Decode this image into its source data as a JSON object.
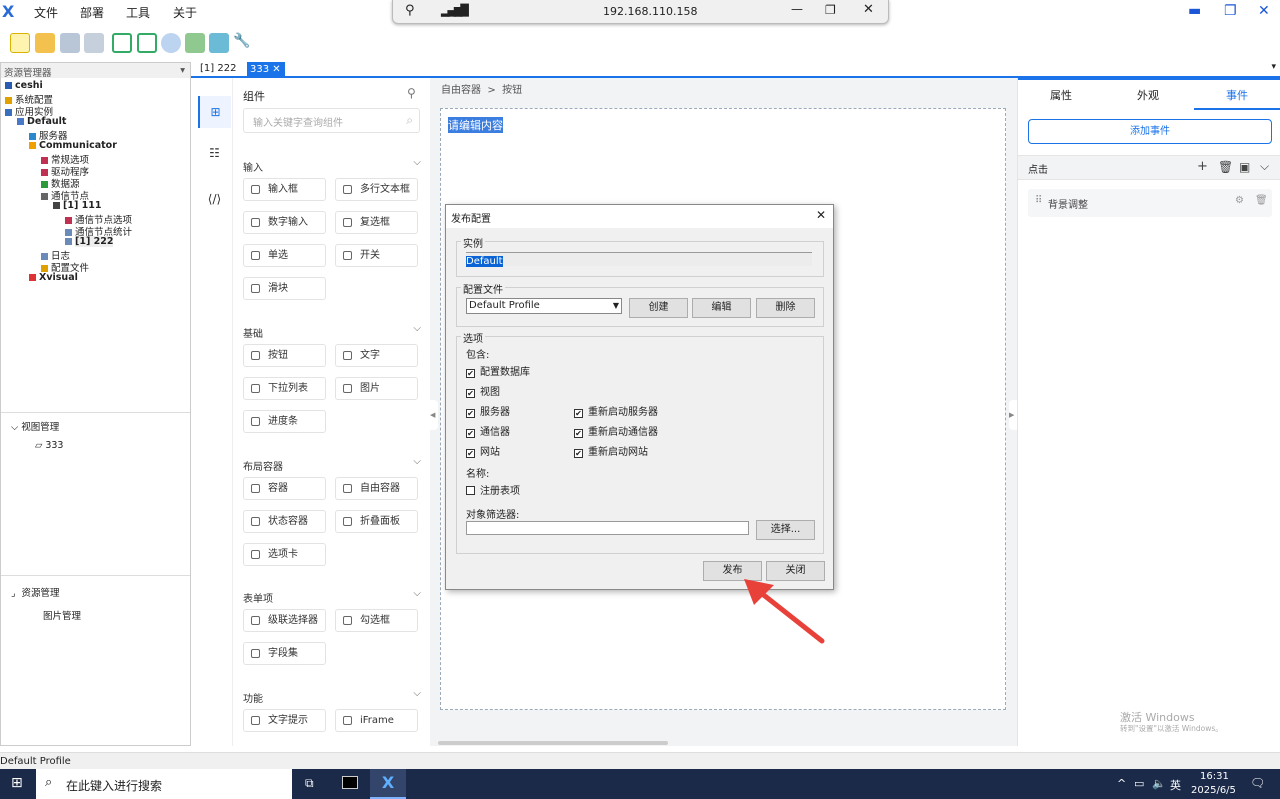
{
  "app": {
    "logo": "X",
    "menu": [
      "文件",
      "部署",
      "工具",
      "关于"
    ]
  },
  "remote": {
    "ip": "192.168.110.158"
  },
  "toolbar": {
    "icons": [
      "new-icon",
      "open-icon",
      "save-icon",
      "save-all-icon",
      "upload-icon",
      "download-icon",
      "help-icon",
      "deploy-icon",
      "add-icon",
      "tools-icon"
    ]
  },
  "tabs": [
    {
      "label": "[1] 222",
      "active": false
    },
    {
      "label": "333",
      "active": true,
      "close": "✕"
    }
  ],
  "explorer": {
    "title": "资源管理器",
    "tree": [
      {
        "label": "ceshi",
        "level": 0
      },
      {
        "label": "系统配置",
        "level": 0
      },
      {
        "label": "应用实例",
        "level": 0
      },
      {
        "label": "Default",
        "level": 1
      },
      {
        "label": "服务器",
        "level": 2
      },
      {
        "label": "Communicator",
        "level": 2
      },
      {
        "label": "常规选项",
        "level": 3
      },
      {
        "label": "驱动程序",
        "level": 3
      },
      {
        "label": "数据源",
        "level": 3
      },
      {
        "label": "通信节点",
        "level": 3
      },
      {
        "label": "[1] 111",
        "level": 4
      },
      {
        "label": "通信节点选项",
        "level": 5
      },
      {
        "label": "通信节点统计",
        "level": 5
      },
      {
        "label": "[1] 222",
        "level": 5
      },
      {
        "label": "日志",
        "level": 3
      },
      {
        "label": "配置文件",
        "level": 3
      },
      {
        "label": "Xvisual",
        "level": 2
      }
    ],
    "views_title": "视图管理",
    "views": [
      "333"
    ],
    "resources_title": "资源管理",
    "resources": [
      "图片管理"
    ]
  },
  "components": {
    "title": "组件",
    "search_placeholder": "输入关键字查询组件",
    "groups": [
      {
        "name": "输入",
        "items": [
          "输入框",
          "多行文本框",
          "数字输入",
          "复选框",
          "单选",
          "开关",
          "滑块"
        ]
      },
      {
        "name": "基础",
        "items": [
          "按钮",
          "文字",
          "下拉列表",
          "图片",
          "进度条"
        ]
      },
      {
        "name": "布局容器",
        "items": [
          "容器",
          "自由容器",
          "状态容器",
          "折叠面板",
          "选项卡"
        ]
      },
      {
        "name": "表单项",
        "items": [
          "级联选择器",
          "勾选框",
          "字段集"
        ]
      },
      {
        "name": "功能",
        "items": [
          "文字提示",
          "iFrame"
        ]
      }
    ]
  },
  "breadcrumb": [
    "自由容器",
    "按钮"
  ],
  "breadcrumb_sep": ">",
  "canvas": {
    "text": "请编辑内容"
  },
  "right": {
    "tabs": [
      "属性",
      "外观",
      "事件"
    ],
    "active_tab": "事件",
    "add_event": "添加事件",
    "event_group": "点击",
    "actions": [
      "背景调整"
    ]
  },
  "dialog": {
    "title": "发布配置",
    "instance_legend": "实例",
    "instance_value": "Default",
    "profile_legend": "配置文件",
    "profile_value": "Default Profile",
    "create": "创建",
    "edit": "编辑",
    "delete": "删除",
    "options_legend": "选项",
    "include_label": "包含:",
    "checks": [
      {
        "label": "配置数据库",
        "checked": true
      },
      {
        "label": "视图",
        "checked": true
      },
      {
        "label": "服务器",
        "checked": true
      },
      {
        "label": "重新启动服务器",
        "checked": true
      },
      {
        "label": "通信器",
        "checked": true
      },
      {
        "label": "重新启动通信器",
        "checked": true
      },
      {
        "label": "网站",
        "checked": true
      },
      {
        "label": "重新启动网站",
        "checked": true
      }
    ],
    "name_label": "名称:",
    "registry": {
      "label": "注册表项",
      "checked": false
    },
    "filter_label": "对象筛选器:",
    "filter_value": "",
    "select": "选择...",
    "publish": "发布",
    "close": "关闭"
  },
  "status": {
    "text": "Default Profile"
  },
  "watermark": {
    "line1": "激活 Windows",
    "line2": "转到\"设置\"以激活 Windows。"
  },
  "taskbar": {
    "search_placeholder": "在此键入进行搜索",
    "ime": "英",
    "time": "16:31",
    "date": "2025/6/5"
  },
  "colors": {
    "accent": "#1a73e8",
    "taskbar": "#1b2a48",
    "arrow": "#e8413a"
  }
}
